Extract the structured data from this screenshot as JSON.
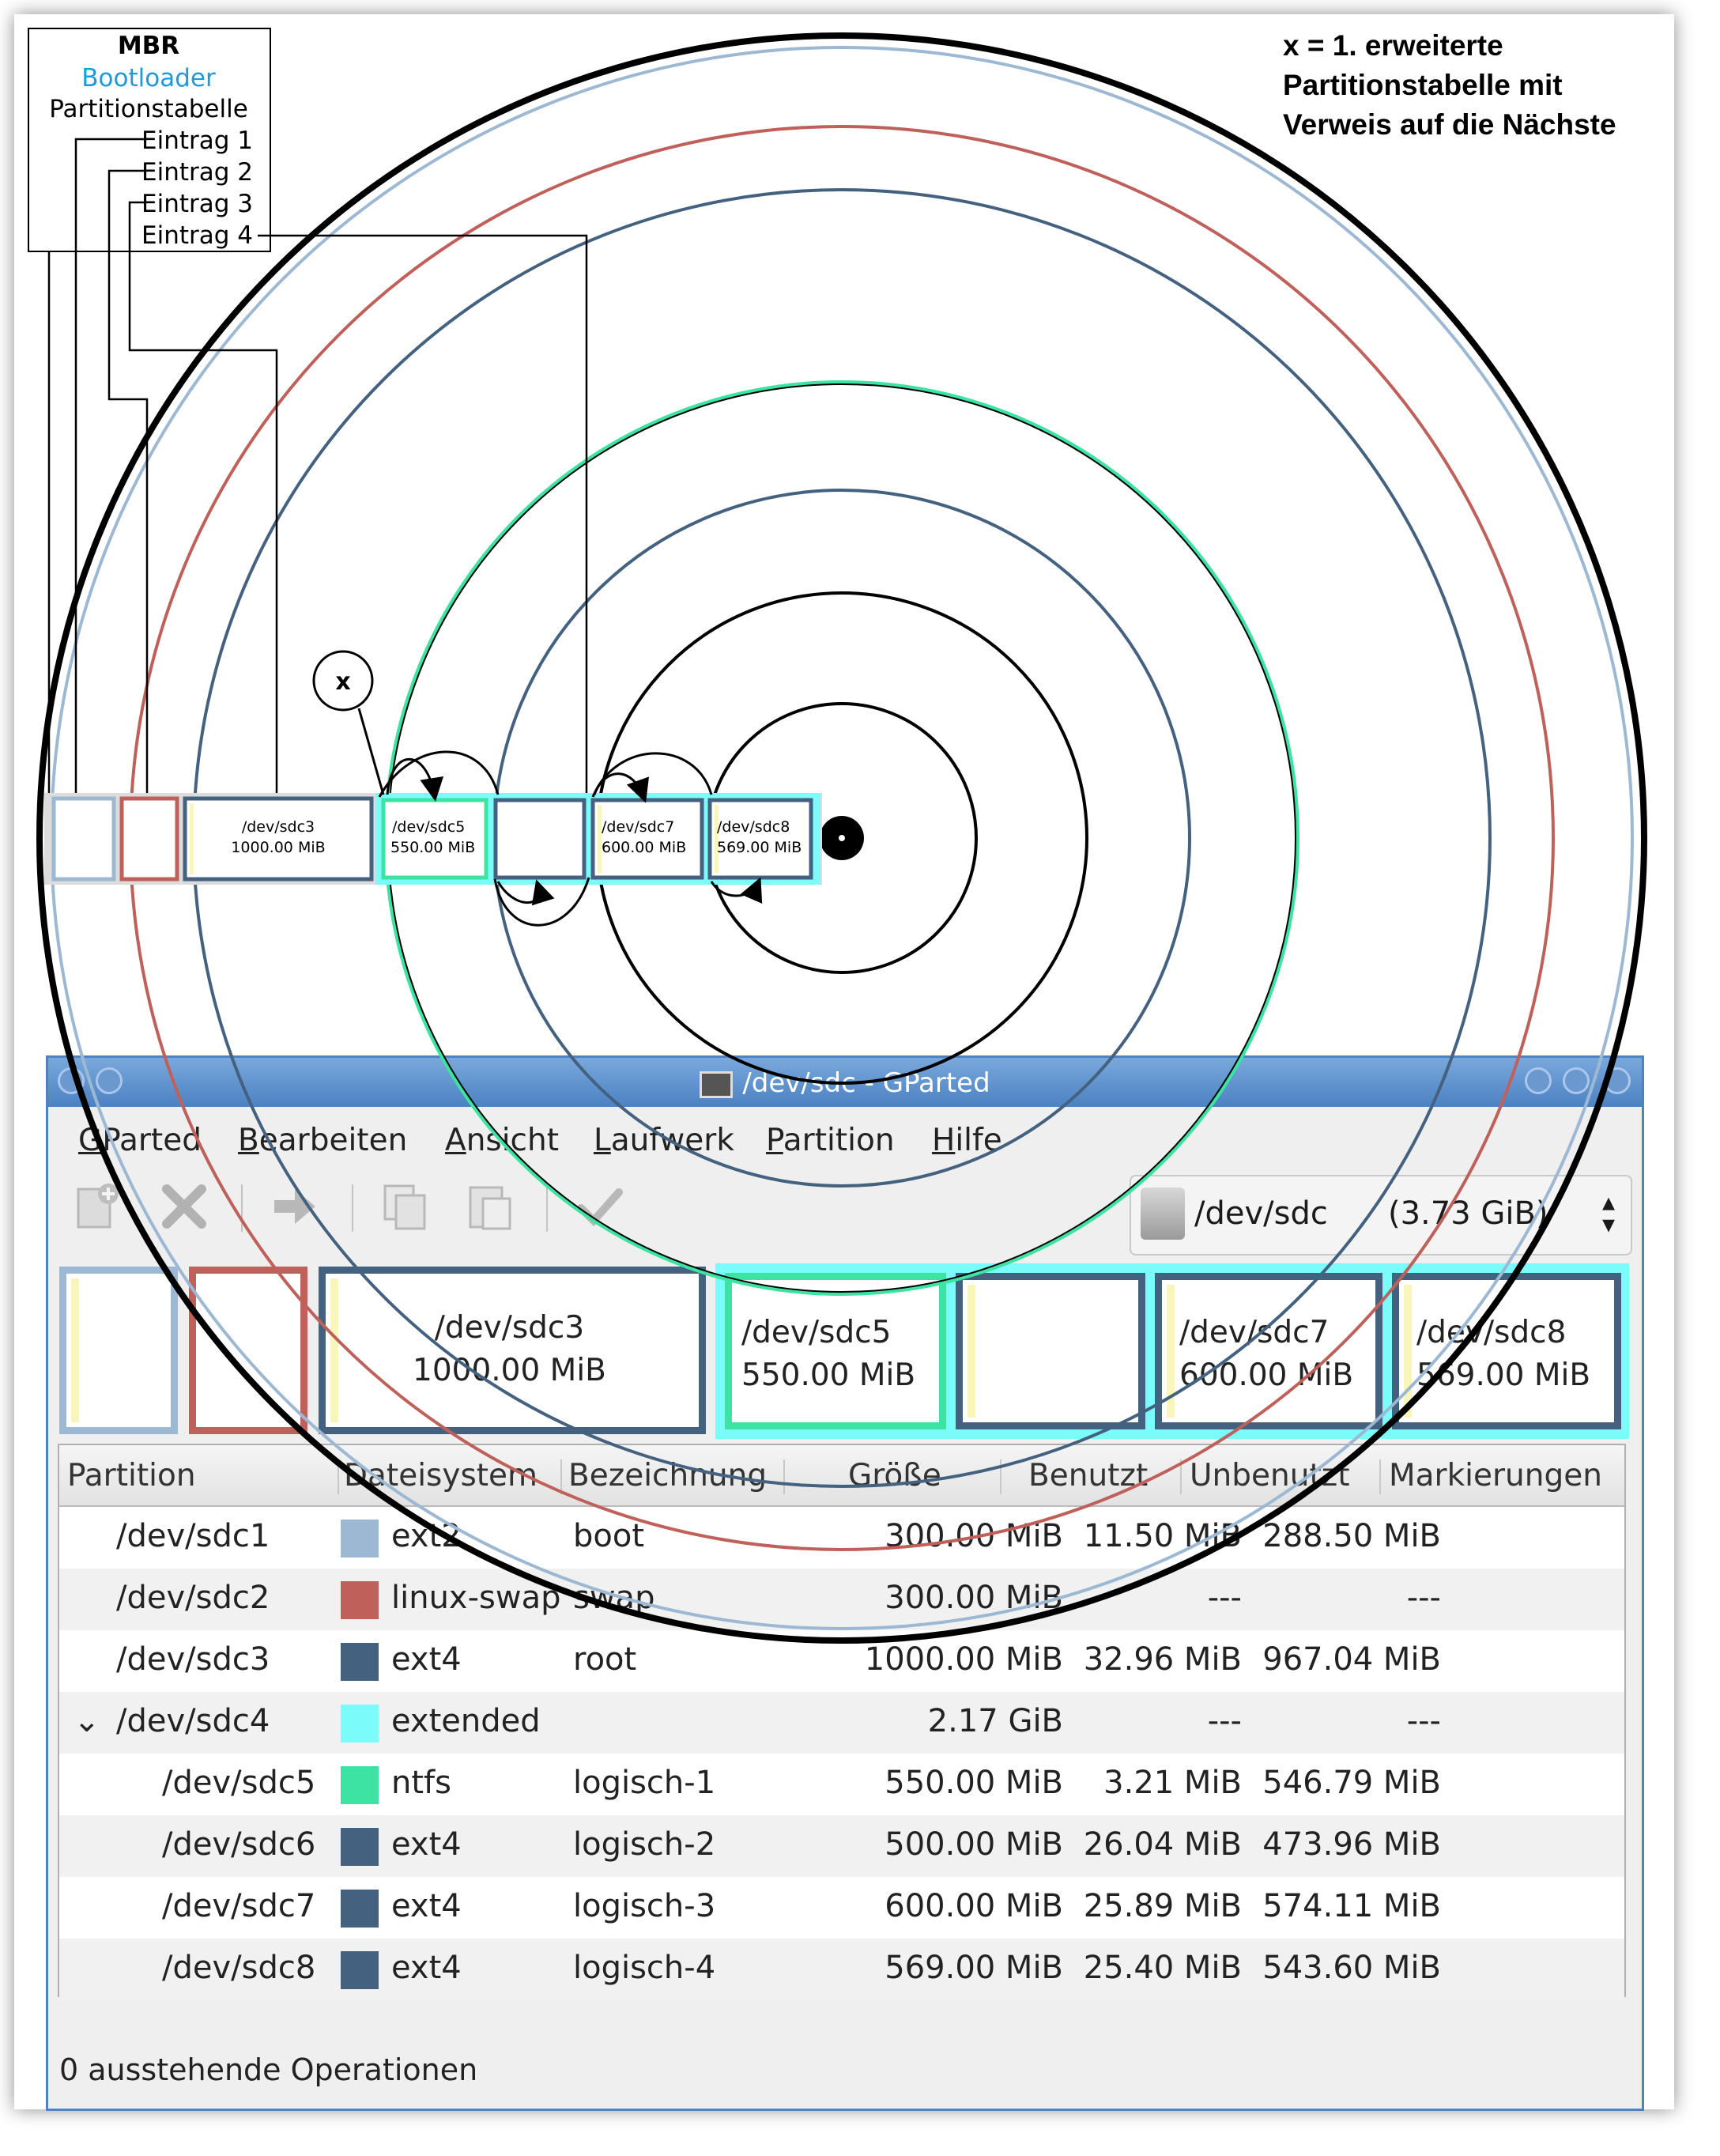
{
  "legend": {
    "line1": "x = 1. erweiterte",
    "line2": "Partitionstabelle mit",
    "line3": "Verweis auf die Nächste"
  },
  "mbr": {
    "title": "MBR",
    "bootloader": "Bootloader",
    "table": "Partitionstabelle",
    "entries": [
      "Eintrag 1",
      "Eintrag 2",
      "Eintrag 3",
      "Eintrag 4"
    ]
  },
  "x_marker": "x",
  "colors": {
    "sdc1": "#9db8d2",
    "sdc2": "#c0605a",
    "ext4": "#44627f",
    "ntfs": "#3de3a3",
    "extended": "#7cfbfb",
    "ring": "#000000",
    "title": "#4e82c0",
    "bootloader": "#1a9be0"
  },
  "diagram_blocks": {
    "sdc3": {
      "name": "/dev/sdc3",
      "size": "1000.00 MiB"
    },
    "sdc5": {
      "name": "/dev/sdc5",
      "size": "550.00 MiB"
    },
    "sdc7": {
      "name": "/dev/sdc7",
      "size": "600.00 MiB"
    },
    "sdc8": {
      "name": "/dev/sdc8",
      "size": "569.00 MiB"
    }
  },
  "window": {
    "title": "/dev/sdc - GParted",
    "menu": [
      {
        "first": "G",
        "rest": "Parted"
      },
      {
        "first": "B",
        "rest": "earbeiten"
      },
      {
        "first": "A",
        "rest": "nsicht"
      },
      {
        "first": "L",
        "rest": "aufwerk"
      },
      {
        "first": "P",
        "rest": "artition"
      },
      {
        "first": "H",
        "rest": "ilfe"
      }
    ],
    "toolbar_icons": [
      "new-partition-icon",
      "delete-icon",
      "resize-move-icon",
      "copy-icon",
      "paste-icon",
      "apply-icon"
    ],
    "device": {
      "name": "/dev/sdc",
      "size": "(3.73 GiB)"
    },
    "map": {
      "sdc3": {
        "name": "/dev/sdc3",
        "size": "1000.00 MiB"
      },
      "sdc5": {
        "name": "/dev/sdc5",
        "size": "550.00 MiB"
      },
      "sdc7": {
        "name": "/dev/sdc7",
        "size": "600.00 MiB"
      },
      "sdc8": {
        "name": "/dev/sdc8",
        "size": "569.00 MiB"
      }
    },
    "columns": [
      "Partition",
      "Dateisystem",
      "Bezeichnung",
      "Größe",
      "Benutzt",
      "Unbenutzt",
      "Markierungen"
    ],
    "rows": [
      {
        "partition": "/dev/sdc1",
        "fs": "ext2",
        "color": "#9db8d2",
        "label": "boot",
        "size": "300.00 MiB",
        "used": "11.50 MiB",
        "unused": "288.50 MiB",
        "flags": ""
      },
      {
        "partition": "/dev/sdc2",
        "fs": "linux-swap",
        "color": "#c0605a",
        "label": "swap",
        "size": "300.00 MiB",
        "used": "---",
        "unused": "---",
        "flags": ""
      },
      {
        "partition": "/dev/sdc3",
        "fs": "ext4",
        "color": "#44627f",
        "label": "root",
        "size": "1000.00 MiB",
        "used": "32.96 MiB",
        "unused": "967.04 MiB",
        "flags": ""
      },
      {
        "partition": "/dev/sdc4",
        "fs": "extended",
        "color": "#7cfbfb",
        "label": "",
        "size": "2.17 GiB",
        "used": "---",
        "unused": "---",
        "flags": ""
      },
      {
        "partition": "/dev/sdc5",
        "fs": "ntfs",
        "color": "#3de3a3",
        "label": "logisch-1",
        "size": "550.00 MiB",
        "used": "3.21 MiB",
        "unused": "546.79 MiB",
        "flags": ""
      },
      {
        "partition": "/dev/sdc6",
        "fs": "ext4",
        "color": "#44627f",
        "label": "logisch-2",
        "size": "500.00 MiB",
        "used": "26.04 MiB",
        "unused": "473.96 MiB",
        "flags": ""
      },
      {
        "partition": "/dev/sdc7",
        "fs": "ext4",
        "color": "#44627f",
        "label": "logisch-3",
        "size": "600.00 MiB",
        "used": "25.89 MiB",
        "unused": "574.11 MiB",
        "flags": ""
      },
      {
        "partition": "/dev/sdc8",
        "fs": "ext4",
        "color": "#44627f",
        "label": "logisch-4",
        "size": "569.00 MiB",
        "used": "25.40 MiB",
        "unused": "543.60 MiB",
        "flags": ""
      }
    ],
    "status": "0 ausstehende Operationen"
  }
}
